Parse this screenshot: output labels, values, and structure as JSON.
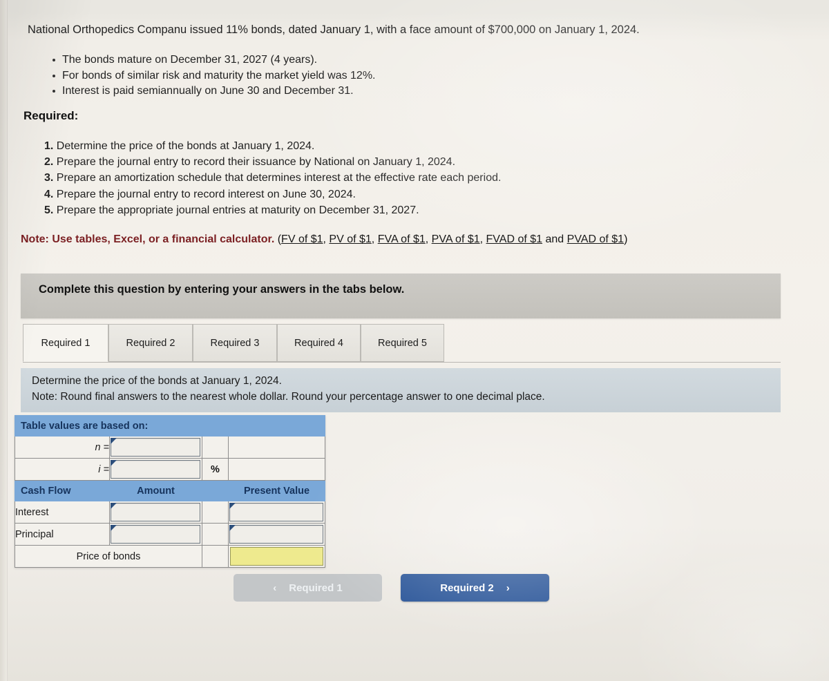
{
  "problem": {
    "intro": "National Orthopedics Companu issued 11% bonds, dated January 1, with a face amount of $700,000 on January 1, 2024.",
    "bullets": [
      "The bonds mature on December 31, 2027 (4 years).",
      "For bonds of similar risk and maturity the market yield was 12%.",
      "Interest is paid semiannually on June 30 and December 31."
    ],
    "required_heading": "Required:",
    "required_items": [
      {
        "num": "1.",
        "text": "Determine the price of the bonds at January 1, 2024."
      },
      {
        "num": "2.",
        "text": "Prepare the journal entry to record their issuance by National on January 1, 2024."
      },
      {
        "num": "3.",
        "text": "Prepare an amortization schedule that determines interest at the effective rate each period."
      },
      {
        "num": "4.",
        "text": "Prepare the journal entry to record interest on June 30, 2024."
      },
      {
        "num": "5.",
        "text": "Prepare the appropriate journal entries at maturity on December 31, 2027."
      }
    ],
    "note_label": "Note:",
    "note_text": "Use tables, Excel, or a financial calculator.",
    "note_links_open": "(",
    "note_links": [
      "FV of $1",
      "PV of $1",
      "FVA of $1",
      "PVA of $1",
      "FVAD of $1"
    ],
    "note_links_conjunction": " and ",
    "note_link_last": "PVAD of $1",
    "note_links_close": ")"
  },
  "instruction_bar": {
    "text": "Complete this question by entering your answers in the tabs below."
  },
  "tabs": {
    "items": [
      {
        "label": "Required 1",
        "active": true
      },
      {
        "label": "Required 2",
        "active": false
      },
      {
        "label": "Required 3",
        "active": false
      },
      {
        "label": "Required 4",
        "active": false
      },
      {
        "label": "Required 5",
        "active": false
      }
    ]
  },
  "task_bar": {
    "line1": "Determine the price of the bonds at January 1, 2024.",
    "line2": "Note: Round final answers to the nearest whole dollar. Round your percentage answer to one decimal place."
  },
  "answer_table": {
    "title": "Table values are based on:",
    "n_label": "n =",
    "n_value": "",
    "i_label": "i =",
    "i_value": "",
    "percent_symbol": "%",
    "columns": {
      "cash_flow": "Cash Flow",
      "amount": "Amount",
      "present_value": "Present Value"
    },
    "rows": [
      {
        "label": "Interest",
        "amount": "",
        "present_value": ""
      },
      {
        "label": "Principal",
        "amount": "",
        "present_value": ""
      }
    ],
    "total_label": "Price of bonds",
    "total_value": ""
  },
  "navigation": {
    "prev_label": "Required 1",
    "prev_chevron": "‹",
    "next_label": "Required 2",
    "next_chevron": "›"
  },
  "colors": {
    "page_background": "#f2efe9",
    "table_header_blue": "#7aa8d8",
    "table_header_text": "#16335c",
    "highlight_yellow": "#eeea8e",
    "primary_button_blue": "#2b5699",
    "disabled_button_gray": "#c3c6c8",
    "gray_bar": "#c6c4bf",
    "task_bar_blue": "#ccd5da",
    "note_red": "#7b1f22"
  }
}
